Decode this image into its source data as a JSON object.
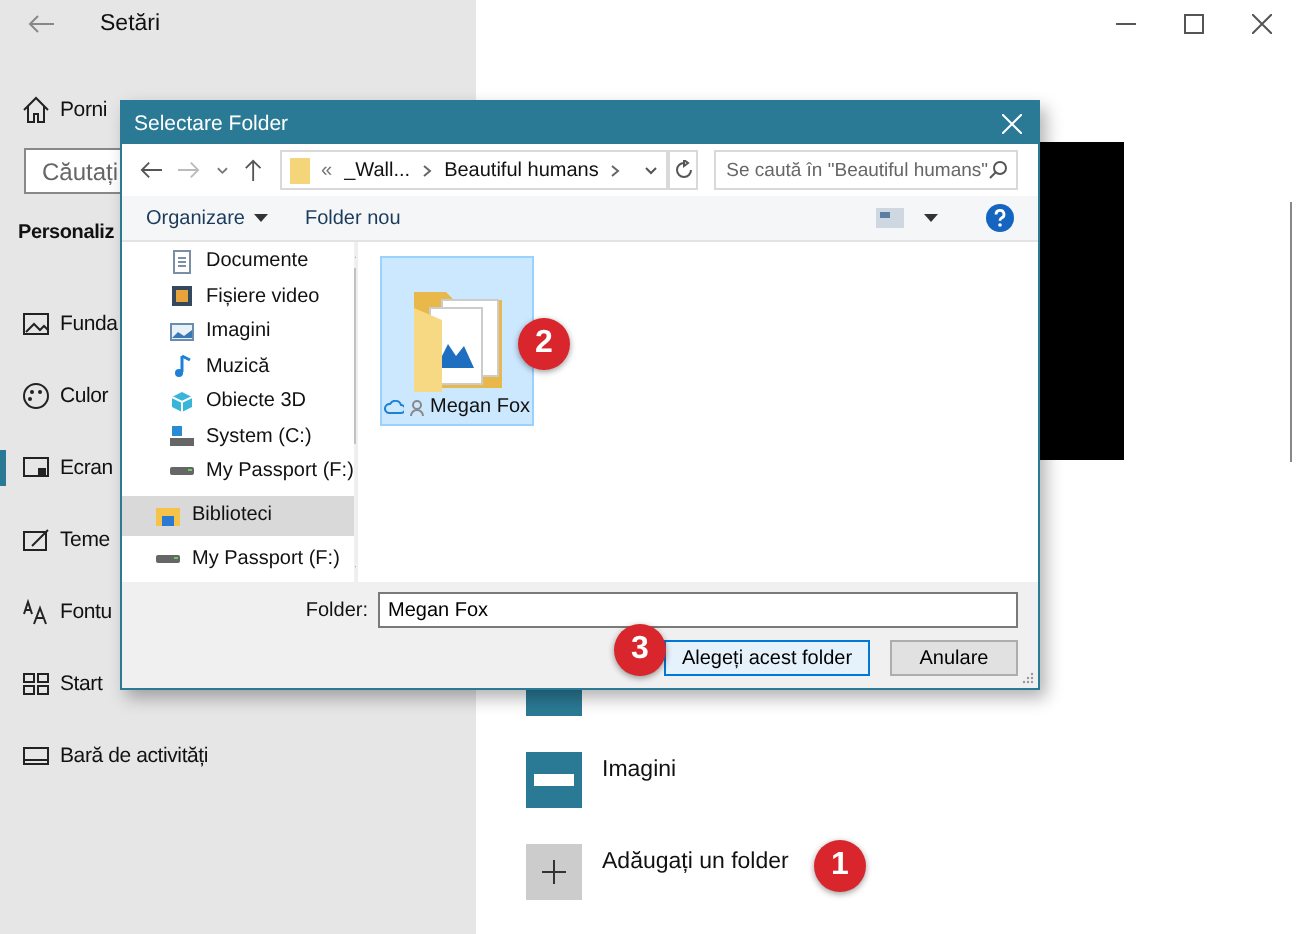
{
  "settings": {
    "title": "Setări",
    "home": "Porni",
    "search": {
      "placeholder": "Căutați"
    },
    "section": "Personaliz",
    "nav": [
      {
        "label": "Funda",
        "kind": "background",
        "selected": false
      },
      {
        "label": "Culor",
        "kind": "colors",
        "selected": false
      },
      {
        "label": "Ecran",
        "kind": "lockscreen",
        "selected": true
      },
      {
        "label": "Teme",
        "kind": "themes",
        "selected": false
      },
      {
        "label": "Fontu",
        "kind": "fonts",
        "selected": false
      },
      {
        "label": "Start",
        "kind": "start",
        "selected": false
      },
      {
        "label": "Bară de activități",
        "kind": "taskbar",
        "selected": false
      }
    ],
    "folders": [
      {
        "label": "Imagini",
        "kind": "folder"
      },
      {
        "label": "Adăugați un folder",
        "kind": "add"
      }
    ]
  },
  "dialog": {
    "title": "Selectare Folder",
    "address": [
      "«",
      "_Wall...",
      "Beautiful humans"
    ],
    "search": {
      "placeholder": "Se caută în \"Beautiful humans\""
    },
    "toolbar": [
      "Organizare",
      "Folder nou"
    ],
    "pc_items": [
      {
        "label": "Documente",
        "kind": "documents",
        "selected": false
      },
      {
        "label": "Fișiere video",
        "kind": "videos",
        "selected": false
      },
      {
        "label": "Imagini",
        "kind": "pictures",
        "selected": false
      },
      {
        "label": "Muzică",
        "kind": "music",
        "selected": false
      },
      {
        "label": "Obiecte 3D",
        "kind": "objects",
        "selected": false
      },
      {
        "label": "System (C:)",
        "kind": "system",
        "selected": false
      },
      {
        "label": "My Passport (F:)",
        "kind": "drive",
        "selected": false
      }
    ],
    "tree": [
      {
        "label": "Biblioteci",
        "kind": "library",
        "selected": true
      },
      {
        "label": "My Passport (F:)",
        "kind": "drive",
        "selected": false
      }
    ],
    "items": [
      {
        "label": "Megan Fox",
        "selected": true
      }
    ],
    "folder_label": "Folder:",
    "folder_value": "Megan Fox",
    "buttons": [
      "Alegeți acest folder",
      "Anulare"
    ]
  },
  "badges": [
    "1",
    "2",
    "3"
  ]
}
